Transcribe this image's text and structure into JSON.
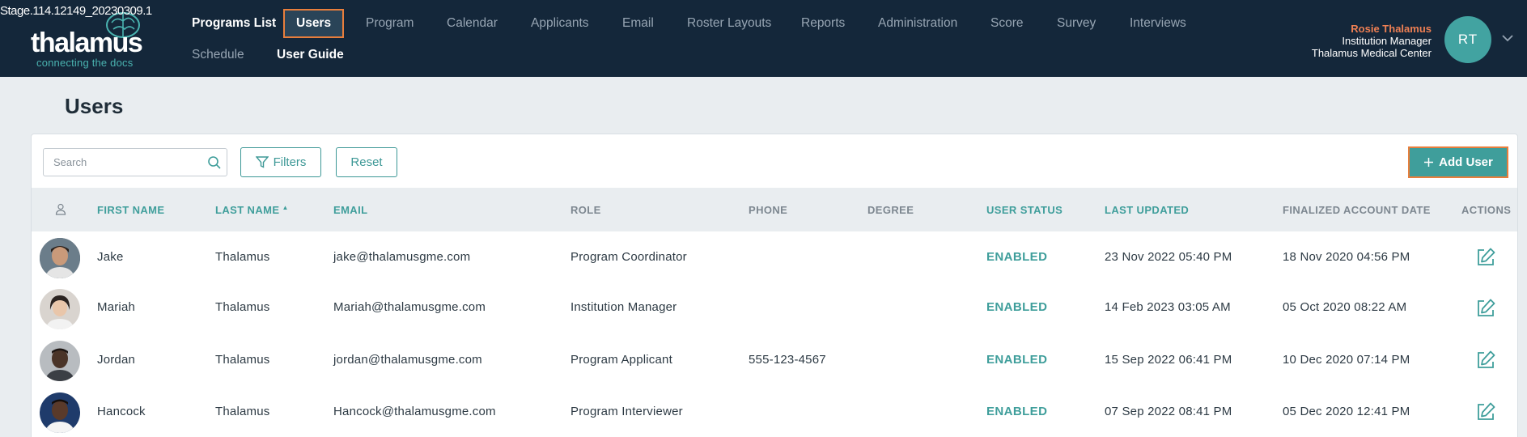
{
  "build": "Stage.114.12149_20230309.1",
  "logo": {
    "word": "thalamus",
    "tagline": "connecting the docs"
  },
  "nav": {
    "programs_list": "Programs List",
    "users": "Users",
    "program": "Program",
    "calendar": "Calendar",
    "applicants": "Applicants",
    "email": "Email",
    "roster_layouts": "Roster Layouts",
    "reports": "Reports",
    "administration": "Administration",
    "score": "Score",
    "survey": "Survey",
    "interviews": "Interviews",
    "schedule": "Schedule",
    "user_guide": "User Guide"
  },
  "user": {
    "name": "Rosie Thalamus",
    "role": "Institution Manager",
    "org": "Thalamus Medical Center",
    "initials": "RT"
  },
  "page": {
    "title": "Users"
  },
  "toolbar": {
    "search_placeholder": "Search",
    "filters_label": "Filters",
    "reset_label": "Reset",
    "add_user_label": "Add User"
  },
  "columns": {
    "first_name": "FIRST NAME",
    "last_name": "LAST NAME",
    "email": "EMAIL",
    "role": "ROLE",
    "phone": "PHONE",
    "degree": "DEGREE",
    "user_status": "USER STATUS",
    "last_updated": "LAST UPDATED",
    "finalized": "FINALIZED ACCOUNT DATE",
    "actions": "ACTIONS"
  },
  "rows": [
    {
      "first": "Jake",
      "last": "Thalamus",
      "email": "jake@thalamusgme.com",
      "role": "Program Coordinator",
      "phone": "",
      "degree": "",
      "status": "ENABLED",
      "updated": "23 Nov 2022 05:40 PM",
      "finalized": "18 Nov 2020 04:56 PM"
    },
    {
      "first": "Mariah",
      "last": "Thalamus",
      "email": "Mariah@thalamusgme.com",
      "role": "Institution Manager",
      "phone": "",
      "degree": "",
      "status": "ENABLED",
      "updated": "14 Feb 2023 03:05 AM",
      "finalized": "05 Oct 2020 08:22 AM"
    },
    {
      "first": "Jordan",
      "last": "Thalamus",
      "email": "jordan@thalamusgme.com",
      "role": "Program Applicant",
      "phone": "555-123-4567",
      "degree": "",
      "status": "ENABLED",
      "updated": "15 Sep 2022 06:41 PM",
      "finalized": "10 Dec 2020 07:14 PM"
    },
    {
      "first": "Hancock",
      "last": "Thalamus",
      "email": "Hancock@thalamusgme.com",
      "role": "Program Interviewer",
      "phone": "",
      "degree": "",
      "status": "ENABLED",
      "updated": "07 Sep 2022 08:41 PM",
      "finalized": "05 Dec 2020 12:41 PM"
    }
  ],
  "colors": {
    "header_bg": "#14273a",
    "accent": "#3f9e9b",
    "highlight": "#e87e3c",
    "user_name": "#ee7f53"
  }
}
